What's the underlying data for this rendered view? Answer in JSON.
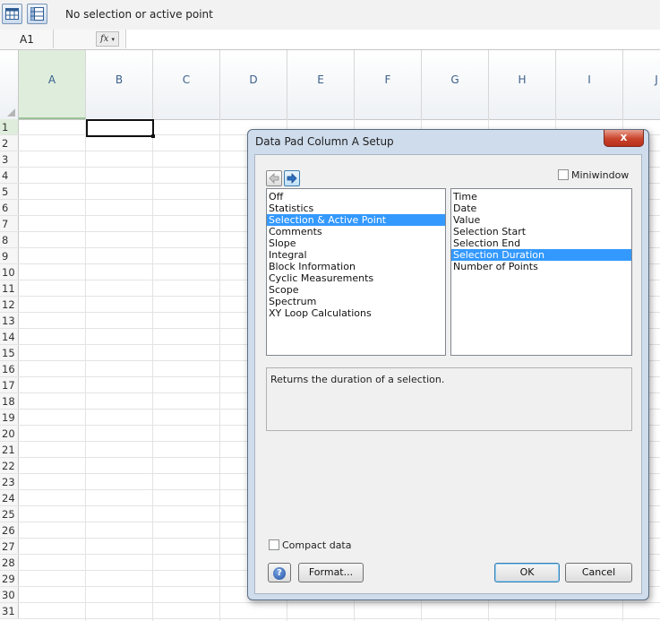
{
  "toolbar": {
    "status_text": "No selection or active point",
    "buttons": [
      {
        "icon": "datapad-view-icon"
      },
      {
        "icon": "datapad-setup-icon"
      }
    ]
  },
  "formula_bar": {
    "cell_ref": "A1",
    "fx_label": "fx",
    "value": ""
  },
  "sheet": {
    "columns": [
      "A",
      "B",
      "C",
      "D",
      "E",
      "F",
      "G",
      "H",
      "I",
      "J"
    ],
    "selected_column": "A",
    "rows": [
      "1",
      "2",
      "3",
      "4",
      "5",
      "6",
      "7",
      "8",
      "9",
      "10",
      "11",
      "12",
      "13",
      "14",
      "15",
      "16",
      "17",
      "18",
      "19",
      "20",
      "21",
      "22",
      "23",
      "24",
      "25",
      "26",
      "27",
      "28",
      "29",
      "30",
      "31"
    ],
    "selected_row": "1",
    "active_cell": "B1"
  },
  "dialog": {
    "title": "Data Pad Column A Setup",
    "close_label": "x",
    "miniwindow_label": "Miniwindow",
    "miniwindow_checked": false,
    "categories": [
      "Off",
      "Statistics",
      "Selection & Active Point",
      "Comments",
      "Slope",
      "Integral",
      "Block Information",
      "Cyclic Measurements",
      "Scope",
      "Spectrum",
      "XY Loop Calculations"
    ],
    "selected_category": "Selection & Active Point",
    "functions": [
      "Time",
      "Date",
      "Value",
      "Selection Start",
      "Selection End",
      "Selection Duration",
      "Number of Points"
    ],
    "selected_function": "Selection Duration",
    "description": "Returns the duration of a selection.",
    "compact_label": "Compact data",
    "compact_checked": false,
    "help_label": "?",
    "format_label": "Format...",
    "ok_label": "OK",
    "cancel_label": "Cancel"
  }
}
